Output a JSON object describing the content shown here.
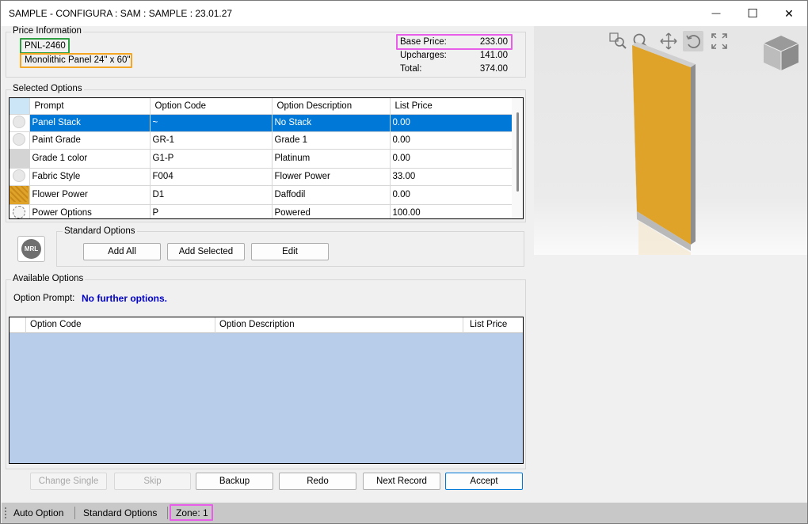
{
  "window": {
    "title": "SAMPLE - CONFIGURA : SAM : SAMPLE : 23.01.27",
    "minimize_glyph": "—",
    "maximize_glyph": "☐",
    "close_glyph": "✕"
  },
  "price_info": {
    "group_label": "Price Information",
    "part_number": "PNL-2460",
    "description": "Monolithic Panel 24\" x 60\"",
    "base_price_label": "Base Price:",
    "base_price": "233.00",
    "upcharges_label": "Upcharges:",
    "upcharges": "141.00",
    "total_label": "Total:",
    "total": "374.00"
  },
  "selected_options": {
    "group_label": "Selected Options",
    "columns": [
      "Prompt",
      "Option Code",
      "Option Description",
      "List Price"
    ],
    "rows": [
      {
        "prompt": "Panel Stack",
        "code": "~",
        "description": "No Stack",
        "price": "0.00",
        "icon": "grey-swatch-icon"
      },
      {
        "prompt": "Paint Grade",
        "code": "GR-1",
        "description": "Grade 1",
        "price": "0.00",
        "icon": "grey-swatch-icon"
      },
      {
        "prompt": "Grade 1 color",
        "code": "G1-P",
        "description": "Platinum",
        "price": "0.00",
        "icon": "platinum-swatch-icon"
      },
      {
        "prompt": "Fabric Style",
        "code": "F004",
        "description": "Flower Power",
        "price": "33.00",
        "icon": "grey-swatch-icon"
      },
      {
        "prompt": "Flower Power",
        "code": "D1",
        "description": "Daffodil",
        "price": "0.00",
        "icon": "daffodil-swatch-icon"
      },
      {
        "prompt": "Power Options",
        "code": "P",
        "description": "Powered",
        "price": "100.00",
        "icon": "power-swatch-icon"
      }
    ]
  },
  "standard_options": {
    "group_label": "Standard Options",
    "logo_text": "MRL",
    "add_all": "Add All",
    "add_selected": "Add Selected",
    "edit": "Edit"
  },
  "available_options": {
    "group_label": "Available Options",
    "prompt_label": "Option Prompt:",
    "prompt_value": "No further options.",
    "columns": [
      "Option Code",
      "Option Description",
      "List Price"
    ]
  },
  "actions": {
    "change_single": "Change Single",
    "skip": "Skip",
    "backup": "Backup",
    "redo": "Redo",
    "next_record": "Next Record",
    "accept": "Accept"
  },
  "statusbar": {
    "auto_option": "Auto Option",
    "standard_options": "Standard Options",
    "zone": "Zone: 1"
  },
  "colors": {
    "selection": "#0078d7",
    "available_grid_bg": "#b8cde9",
    "panel_fabric": "#e0a32a",
    "highlight_green": "#2ea043",
    "highlight_orange": "#f5a623",
    "highlight_pink": "#e85ee8"
  }
}
